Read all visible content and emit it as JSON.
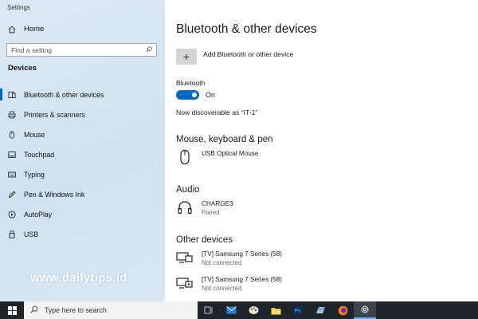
{
  "window": {
    "title": "Settings"
  },
  "sidebar": {
    "home_label": "Home",
    "search_placeholder": "Find a setting",
    "section_label": "Devices",
    "items": [
      {
        "label": "Bluetooth & other devices",
        "icon": "bluetooth-icon",
        "active": true
      },
      {
        "label": "Printers & scanners",
        "icon": "printer-icon",
        "active": false
      },
      {
        "label": "Mouse",
        "icon": "mouse-icon",
        "active": false
      },
      {
        "label": "Touchpad",
        "icon": "touchpad-icon",
        "active": false
      },
      {
        "label": "Typing",
        "icon": "keyboard-icon",
        "active": false
      },
      {
        "label": "Pen & Windows Ink",
        "icon": "pen-icon",
        "active": false
      },
      {
        "label": "AutoPlay",
        "icon": "autoplay-icon",
        "active": false
      },
      {
        "label": "USB",
        "icon": "usb-icon",
        "active": false
      }
    ]
  },
  "watermark": "www.dailytips.id",
  "main": {
    "title": "Bluetooth & other devices",
    "add_device_label": "Add Bluetooth or other device",
    "bluetooth_label": "Bluetooth",
    "toggle_state": "On",
    "discoverable_text": "Now discoverable as “IT-1”",
    "sections": {
      "mouse_keyboard_pen": {
        "title": "Mouse, keyboard & pen",
        "devices": [
          {
            "name": "USB Optical Mouse",
            "icon": "mouse-icon"
          }
        ]
      },
      "audio": {
        "title": "Audio",
        "devices": [
          {
            "name": "CHARGE3",
            "status": "Paired",
            "icon": "headphones-icon"
          }
        ]
      },
      "other_devices": {
        "title": "Other devices",
        "devices": [
          {
            "name": "[TV] Samsung 7 Series (58)",
            "status": "Not connected",
            "icon": "display-icon"
          },
          {
            "name": "[TV] Samsung 7 Series (58)",
            "status": "Not connected",
            "icon": "media-device-icon"
          }
        ]
      }
    }
  },
  "taskbar": {
    "search_placeholder": "Type here to search",
    "apps": [
      "task-view-icon",
      "mail-icon",
      "paint-icon",
      "file-explorer-icon",
      "photoshop-icon",
      "app-icon",
      "firefox-icon",
      "settings-gear-icon"
    ]
  },
  "colors": {
    "accent": "#0067c0",
    "taskbar": "#1f242a",
    "sidebar": "#d3e4f2"
  }
}
